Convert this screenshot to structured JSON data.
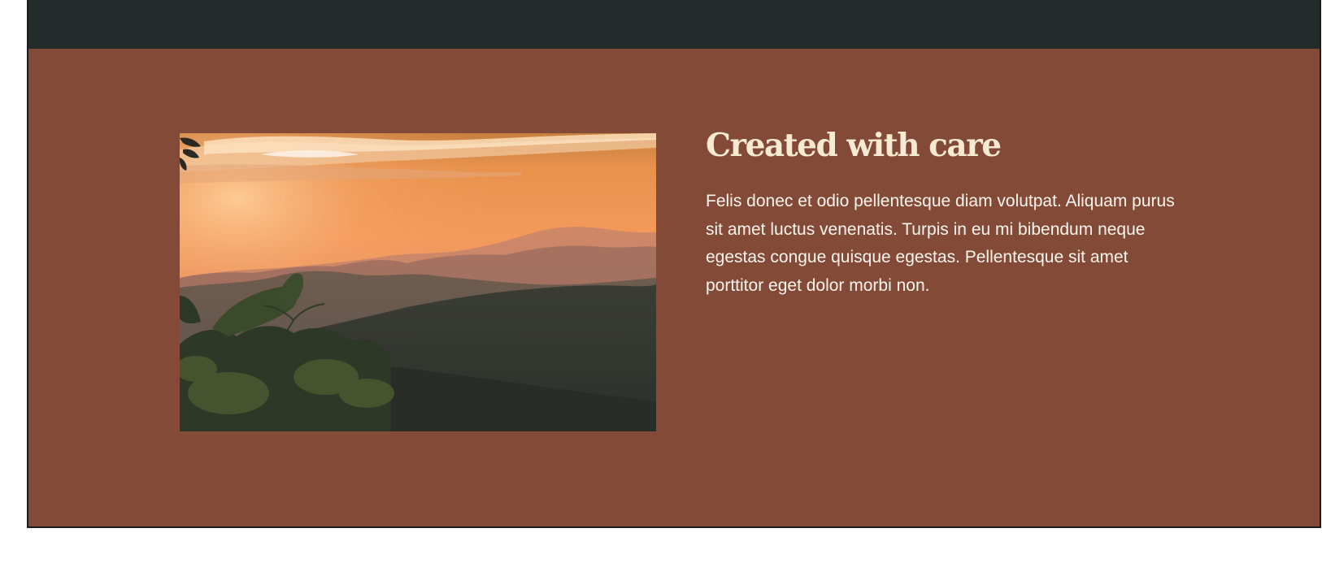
{
  "section": {
    "heading": "Created with care",
    "paragraph": "Felis donec et odio pellentesque diam volutpat. Aliquam purus sit amet luctus venenatis. Turpis in eu mi bibendum neque egestas congue quisque egestas. Pellentesque sit amet porttitor eget dolor morbi non.",
    "image": {
      "subject": "sunset-over-mountain-ranges-photo"
    }
  },
  "colors": {
    "topbar": "#232b2b",
    "section_background": "#844a38",
    "heading": "#f7ead3",
    "paragraph": "#fbf5ee"
  }
}
